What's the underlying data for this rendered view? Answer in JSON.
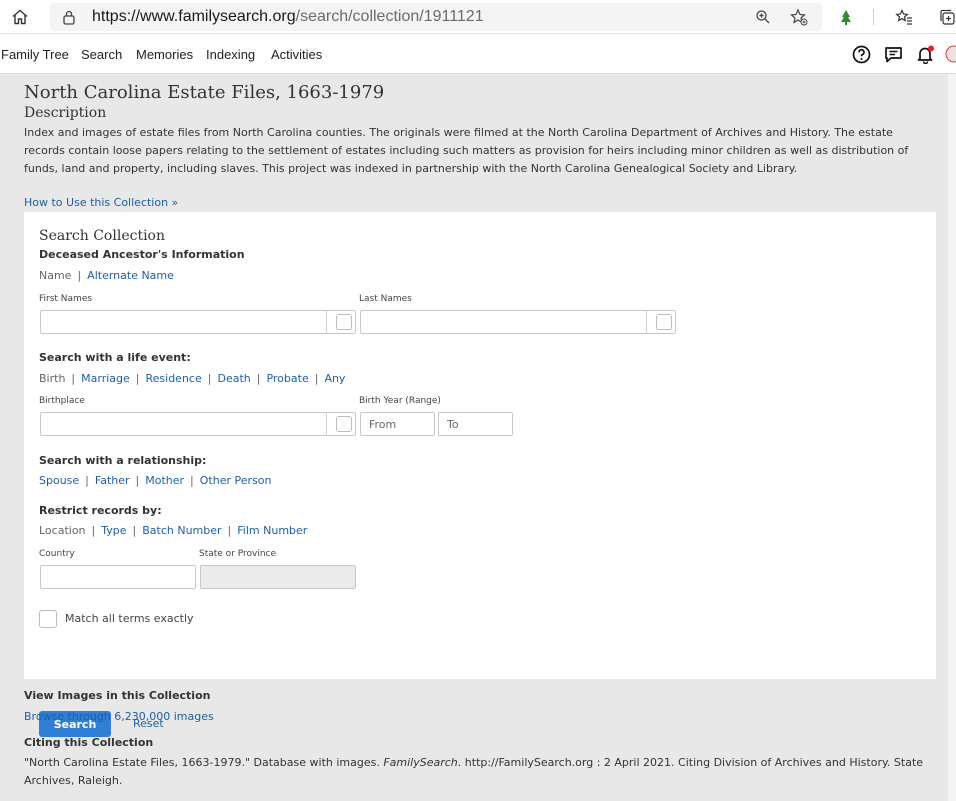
{
  "browser": {
    "url_domain": "https://www.familysearch.org",
    "url_path": "/search/collection/1911121"
  },
  "nav": {
    "items": [
      "Family Tree",
      "Search",
      "Memories",
      "Indexing",
      "Activities"
    ]
  },
  "page": {
    "title": "North Carolina Estate Files, 1663-1979",
    "description_heading": "Description",
    "description": "Index and images of estate files from North Carolina counties. The originals were filmed at the North Carolina Department of Archives and History. The estate records contain loose papers relating to the settlement of estates including such matters as provision for heirs including minor children as well as distribution of funds, land and property, including slaves. This project was indexed in partnership with the North Carolina Genealogical Society and Library.",
    "how_to_link": "How to Use this Collection »"
  },
  "search": {
    "title": "Search Collection",
    "ancestor_heading": "Deceased Ancestor's Information",
    "name_tab": "Name",
    "alternate_name_tab": "Alternate Name",
    "first_names_label": "First Names",
    "last_names_label": "Last Names",
    "life_event_heading": "Search with a life event:",
    "life_events": [
      "Birth",
      "Marriage",
      "Residence",
      "Death",
      "Probate",
      "Any"
    ],
    "birthplace_label": "Birthplace",
    "birth_year_label": "Birth Year (Range)",
    "from_placeholder": "From",
    "to_placeholder": "To",
    "relationship_heading": "Search with a relationship:",
    "relationships": [
      "Spouse",
      "Father",
      "Mother",
      "Other Person"
    ],
    "restrict_heading": "Restrict records by:",
    "restrict_options": [
      "Location",
      "Type",
      "Batch Number",
      "Film Number"
    ],
    "country_label": "Country",
    "state_label": "State or Province",
    "match_label": "Match all terms exactly",
    "search_button": "Search",
    "reset_link": "Reset"
  },
  "images": {
    "heading": "View Images in this Collection",
    "browse_link": "Browse through 6,230,000 images"
  },
  "citation": {
    "heading": "Citing this Collection",
    "part1": "\"North Carolina Estate Files, 1663-1979.\" Database with images. ",
    "source": "FamilySearch",
    "part2": ". http://FamilySearch.org : 2 April 2021. Citing Division of Archives and History. State Archives, Raleigh."
  },
  "colors": {
    "link": "#1f5fa8",
    "button": "#2f7fd6",
    "background": "#e8e8e8"
  }
}
